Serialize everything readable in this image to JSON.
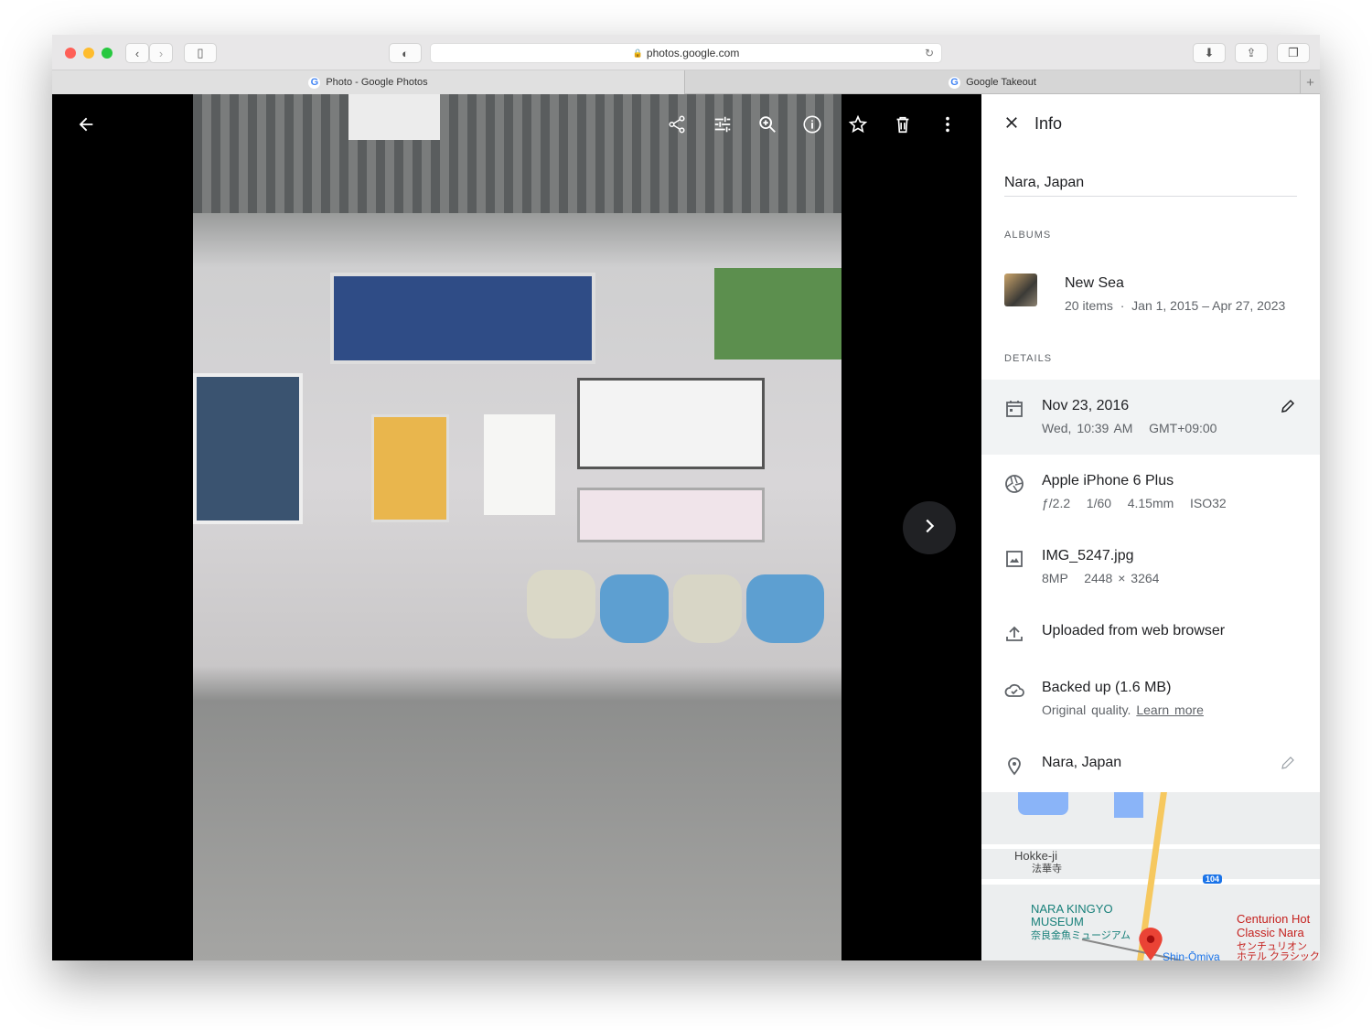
{
  "browser": {
    "url": "photos.google.com",
    "tabs": [
      {
        "label": "Photo - Google Photos",
        "active": true
      },
      {
        "label": "Google Takeout",
        "active": false
      }
    ]
  },
  "viewer": {
    "icons": [
      "back-arrow-icon",
      "share-icon",
      "edit-icon",
      "zoom-in-icon",
      "info-icon",
      "star-icon",
      "trash-icon",
      "more-vert-icon",
      "chevron-right-icon"
    ]
  },
  "info": {
    "title": "Info",
    "description": "Nara, Japan",
    "albums_header": "ALBUMS",
    "album": {
      "name": "New Sea",
      "items": "20 items",
      "dates": "Jan 1, 2015 – Apr 27, 2023"
    },
    "details_header": "DETAILS",
    "date": {
      "line1": "Nov 23, 2016",
      "line2": "Wed, 10:39 AM   GMT+09:00"
    },
    "camera": {
      "line1": "Apple iPhone 6 Plus",
      "line2": "ƒ/2.2   1/60   4.15mm   ISO32"
    },
    "file": {
      "line1": "IMG_5247.jpg",
      "line2": "8MP   2448 × 3264"
    },
    "upload": {
      "line1": "Uploaded from web browser"
    },
    "backup": {
      "line1": "Backed up (1.6 MB)",
      "line2": "Original quality.",
      "link": "Learn more"
    },
    "location": {
      "line1": "Nara, Japan"
    },
    "map": {
      "labels": [
        "Hokke-ji",
        "法華寺",
        "104",
        "NARA KINGYO",
        "MUSEUM",
        "奈良金魚ミュージアム",
        "Centurion Hot",
        "Classic Nara",
        "センチュリオン",
        "ホテル クラシック",
        "Shin-Ōmiya"
      ]
    }
  }
}
